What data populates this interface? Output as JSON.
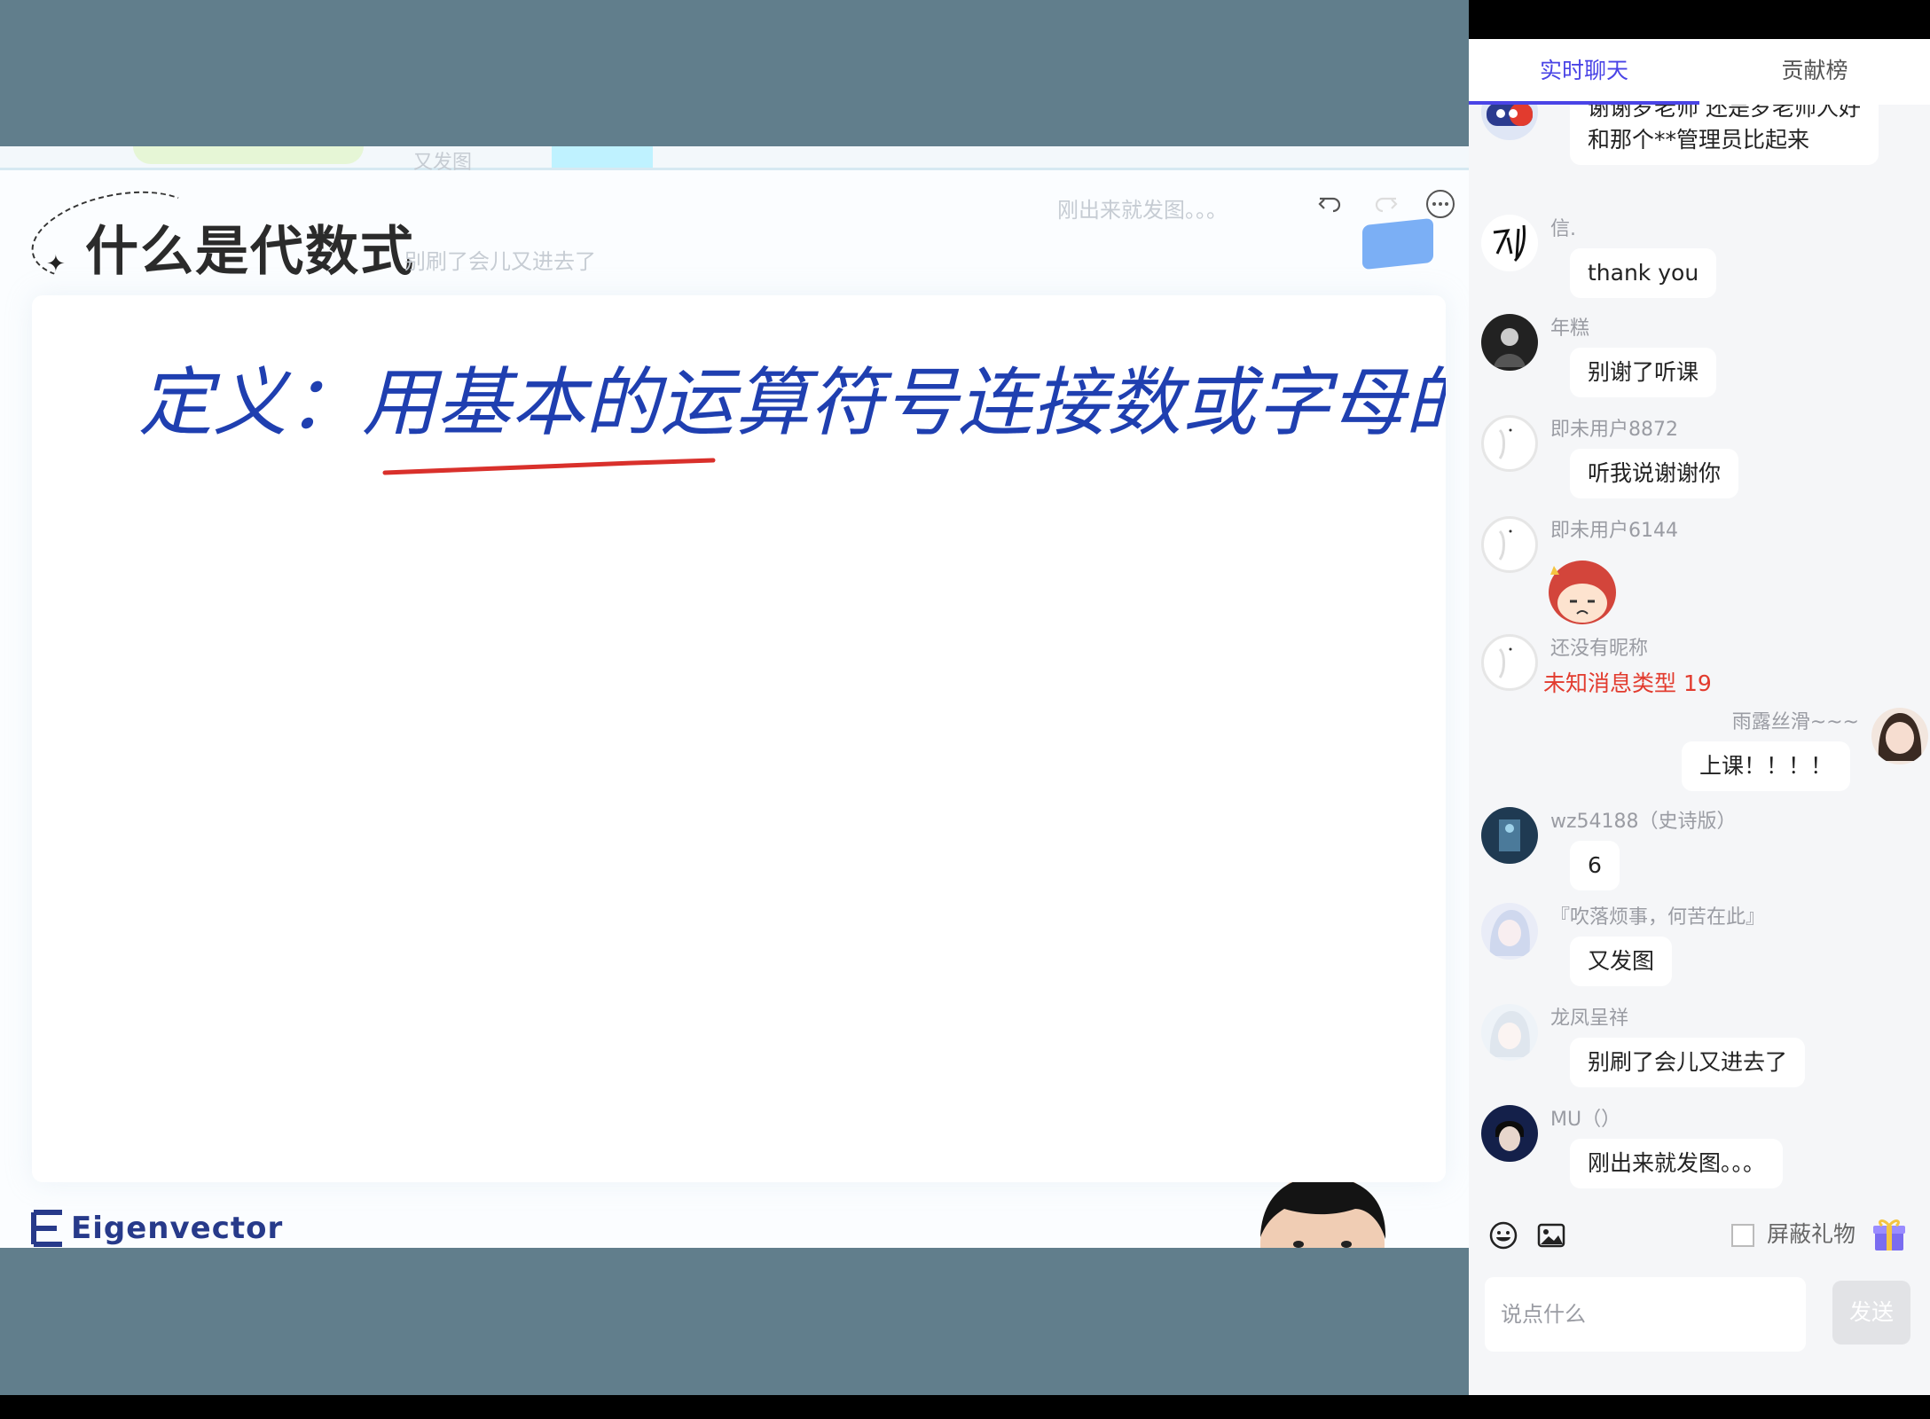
{
  "slide": {
    "title": "什么是代数式",
    "handwriting": "定义：用基本的运算符号连接数或字母的式子.",
    "ghost_top": "又发图",
    "ghost_a": "刚出来就发图。。。",
    "ghost_b": "别刷了会儿又进去了",
    "logo": "Eigenvector"
  },
  "tabs": [
    "实时聊天",
    "贡献榜"
  ],
  "messages": [
    {
      "user": "",
      "text_lines": [
        "谢谢罗老师  还是罗老师人好",
        "和那个**管理员比起来"
      ]
    },
    {
      "user": "信.",
      "text": "thank you"
    },
    {
      "user": "年糕",
      "text": "别谢了听课"
    },
    {
      "user": "即未用户8872",
      "text": "听我说谢谢你"
    },
    {
      "user": "即未用户6144",
      "sticker": "anime-sticker"
    },
    {
      "user": "还没有昵称",
      "system": "未知消息类型 19"
    },
    {
      "user": "雨露丝滑~~~",
      "text": "上课！！！！"
    },
    {
      "user": "wz54188（史诗版）",
      "text": "6"
    },
    {
      "user": "『吹落烦事，何苦在此』",
      "text": "又发图"
    },
    {
      "user": "龙凤呈祥",
      "text": "别刷了会儿又进去了"
    },
    {
      "user": "MU（）",
      "text": "刚出来就发图。。。"
    }
  ],
  "composer": {
    "placeholder": "说点什么",
    "send_label": "发送",
    "block_gifts_label": "屏蔽礼物",
    "block_gifts_checked": false
  },
  "colors": {
    "accent": "#4a44e6",
    "stage_bg": "#617e8c",
    "error": "#e23b2e"
  }
}
